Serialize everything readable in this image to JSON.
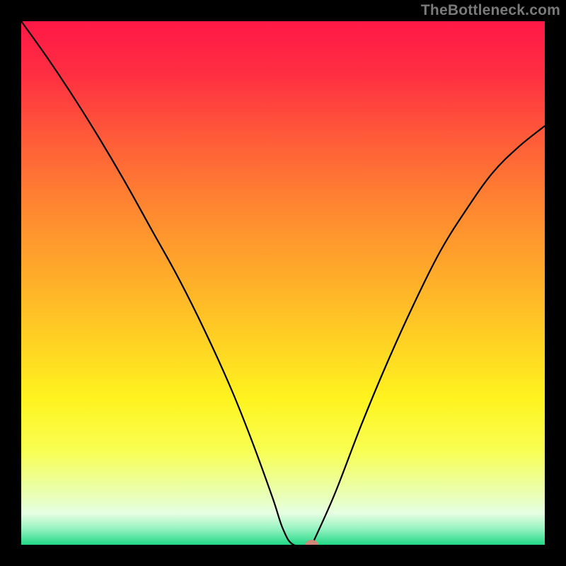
{
  "watermark": "TheBottleneck.com",
  "chart_data": {
    "type": "line",
    "title": "",
    "xlabel": "",
    "ylabel": "",
    "xlim": [
      0,
      1
    ],
    "ylim": [
      0,
      1
    ],
    "background_gradient": {
      "stops": [
        {
          "pos": 0.0,
          "color": "#ff1847"
        },
        {
          "pos": 0.1,
          "color": "#ff2e42"
        },
        {
          "pos": 0.22,
          "color": "#ff5a39"
        },
        {
          "pos": 0.35,
          "color": "#ff8531"
        },
        {
          "pos": 0.48,
          "color": "#ffaa2a"
        },
        {
          "pos": 0.6,
          "color": "#ffce24"
        },
        {
          "pos": 0.72,
          "color": "#fff31f"
        },
        {
          "pos": 0.82,
          "color": "#f8ff52"
        },
        {
          "pos": 0.9,
          "color": "#eaffb0"
        },
        {
          "pos": 0.94,
          "color": "#e6ffe2"
        },
        {
          "pos": 0.97,
          "color": "#94f2c0"
        },
        {
          "pos": 1.0,
          "color": "#22d887"
        }
      ]
    },
    "curve": {
      "x": [
        0.0,
        0.05,
        0.1,
        0.15,
        0.2,
        0.25,
        0.3,
        0.35,
        0.4,
        0.44,
        0.48,
        0.5,
        0.52,
        0.555,
        0.56,
        0.6,
        0.65,
        0.7,
        0.75,
        0.8,
        0.85,
        0.9,
        0.95,
        1.0
      ],
      "y": [
        1.0,
        0.93,
        0.855,
        0.775,
        0.69,
        0.6,
        0.51,
        0.41,
        0.3,
        0.2,
        0.09,
        0.03,
        0.0,
        0.0,
        0.01,
        0.1,
        0.23,
        0.35,
        0.46,
        0.56,
        0.64,
        0.71,
        0.76,
        0.8
      ],
      "stroke": "#000000",
      "width": 2.2
    },
    "marker": {
      "x": 0.555,
      "y": 0.0,
      "rx": 9,
      "ry": 7,
      "fill": "#d08878"
    }
  }
}
